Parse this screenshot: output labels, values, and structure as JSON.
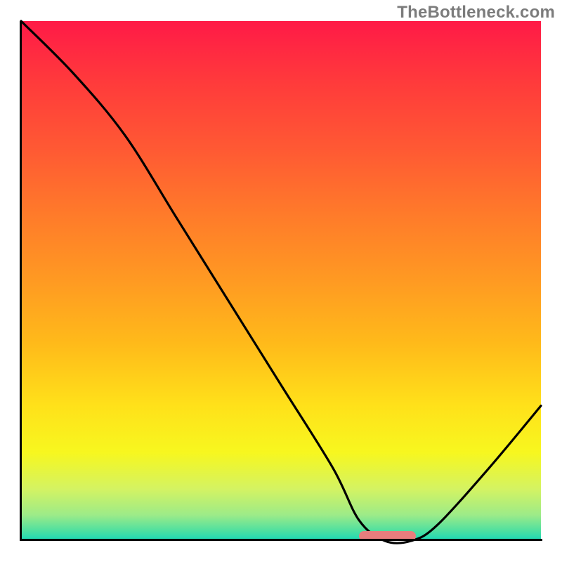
{
  "watermark": "TheBottleneck.com",
  "chart_data": {
    "type": "line",
    "title": "",
    "xlabel": "",
    "ylabel": "",
    "xlim": [
      0,
      100
    ],
    "ylim": [
      0,
      100
    ],
    "x": [
      0,
      10,
      20,
      30,
      40,
      50,
      60,
      65,
      70,
      75,
      80,
      90,
      100
    ],
    "y": [
      100,
      90,
      78,
      62,
      46,
      30,
      14,
      4,
      0,
      0,
      3,
      14,
      26
    ],
    "optimum_range_x": [
      65,
      76
    ],
    "marker_color": "#e87d7d",
    "gradient_stops": [
      {
        "pct": 0,
        "color": "#ff1a47"
      },
      {
        "pct": 25,
        "color": "#ff5a33"
      },
      {
        "pct": 50,
        "color": "#ff9a22"
      },
      {
        "pct": 74,
        "color": "#ffe11a"
      },
      {
        "pct": 90,
        "color": "#d4f362"
      },
      {
        "pct": 100,
        "color": "#18d8b8"
      }
    ]
  }
}
